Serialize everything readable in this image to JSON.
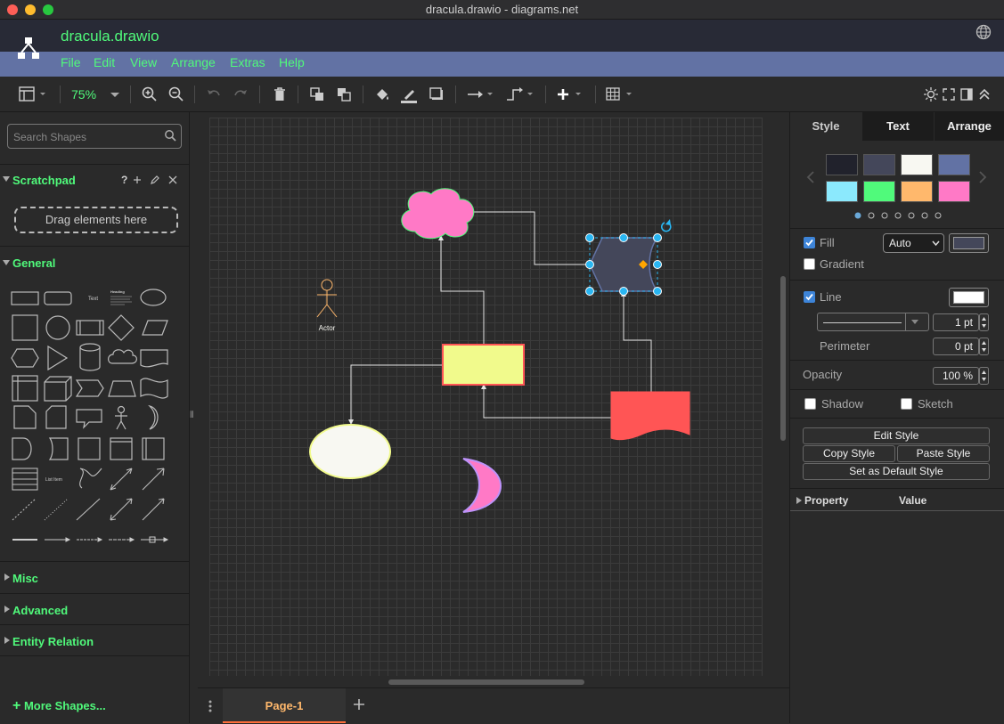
{
  "window": {
    "title": "dracula.drawio - diagrams.net"
  },
  "app": {
    "filename": "dracula.drawio"
  },
  "menu": [
    "File",
    "Edit",
    "View",
    "Arrange",
    "Extras",
    "Help"
  ],
  "toolbar": {
    "zoom": "75%"
  },
  "sidebar": {
    "search_placeholder": "Search Shapes",
    "scratchpad": {
      "label": "Scratchpad",
      "help": "?",
      "drag_hint": "Drag elements here"
    },
    "sections": [
      "General",
      "Misc",
      "Advanced",
      "Entity Relation"
    ],
    "general_text_shapes": {
      "text": "Text",
      "heading": "Heading",
      "list": "List Item"
    },
    "more_shapes": "More Shapes..."
  },
  "canvas": {
    "actor_label": "Actor"
  },
  "pages": {
    "current": "Page-1"
  },
  "format_panel": {
    "tabs": [
      "Style",
      "Text",
      "Arrange"
    ],
    "swatches": [
      "#21222c",
      "#44475a",
      "#f8f8f2",
      "#6272a4",
      "#8be9fd",
      "#50fa7b",
      "#ffb86c",
      "#ff79c6"
    ],
    "fill": {
      "label": "Fill",
      "checked": true,
      "mode": "Auto",
      "color": "#44475a"
    },
    "gradient": {
      "label": "Gradient",
      "checked": false
    },
    "line": {
      "label": "Line",
      "checked": true,
      "color": "#ffffff",
      "width": "1 pt"
    },
    "perimeter": {
      "label": "Perimeter",
      "value": "0 pt"
    },
    "opacity": {
      "label": "Opacity",
      "value": "100 %"
    },
    "shadow": {
      "label": "Shadow",
      "checked": false
    },
    "sketch": {
      "label": "Sketch",
      "checked": false
    },
    "buttons": {
      "edit_style": "Edit Style",
      "copy_style": "Copy Style",
      "paste_style": "Paste Style",
      "set_default": "Set as Default Style"
    },
    "table": {
      "property": "Property",
      "value": "Value"
    }
  },
  "colors": {
    "accent": "#50fa7b",
    "menubar": "#6272a4",
    "header": "#282a36",
    "selection": "#29b6f2"
  }
}
